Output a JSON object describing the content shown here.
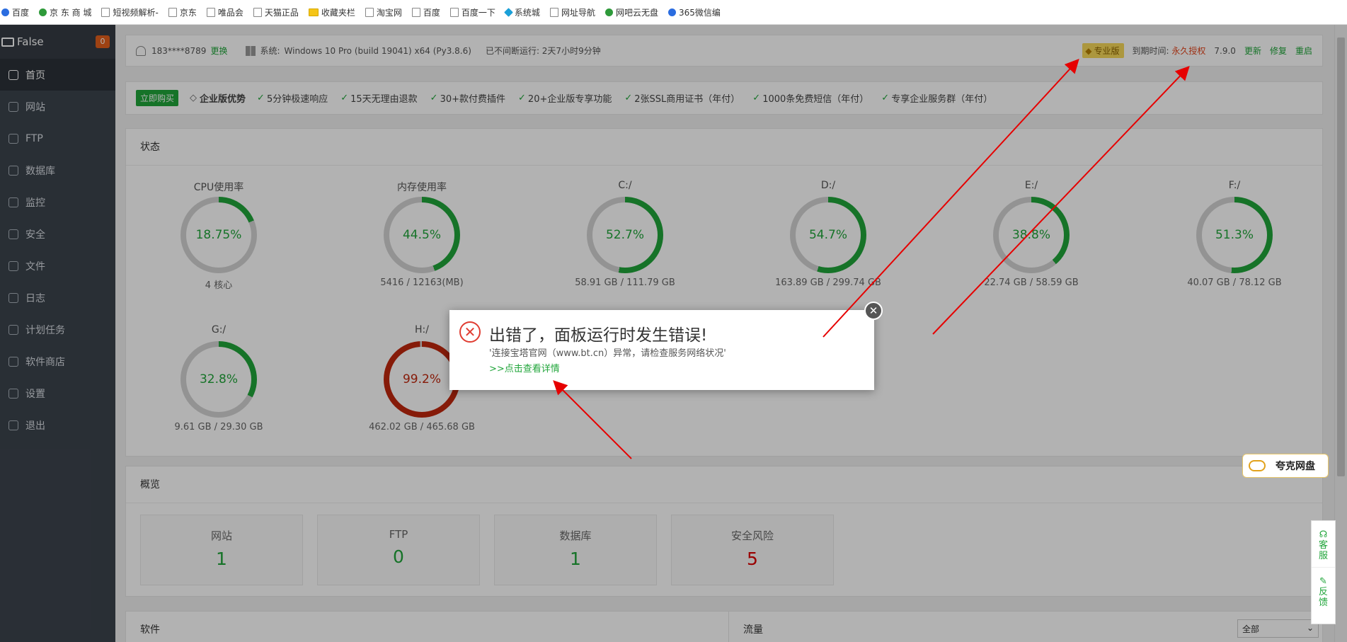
{
  "bookmarks": [
    {
      "label": "百度",
      "icon": "baidu-icon"
    },
    {
      "label": "京 东 商 城",
      "icon": "jd-icon"
    },
    {
      "label": "短视频解析-",
      "icon": "page-icon"
    },
    {
      "label": "京东",
      "icon": "page-icon"
    },
    {
      "label": "唯品会",
      "icon": "page-icon"
    },
    {
      "label": "天猫正品",
      "icon": "page-icon"
    },
    {
      "label": "收藏夹栏",
      "icon": "folder-icon"
    },
    {
      "label": "淘宝网",
      "icon": "page-icon"
    },
    {
      "label": "百度",
      "icon": "page-icon"
    },
    {
      "label": "百度一下",
      "icon": "page-icon"
    },
    {
      "label": "系统城",
      "icon": "xitongcheng-icon"
    },
    {
      "label": "网址导航",
      "icon": "page-icon"
    },
    {
      "label": "网吧云无盘",
      "icon": "wangba-icon"
    },
    {
      "label": "365微信编",
      "icon": "wechat-editor-icon"
    }
  ],
  "sidebar": {
    "host": "False",
    "badge": "0",
    "items": [
      {
        "label": "首页",
        "icon": "home-icon"
      },
      {
        "label": "网站",
        "icon": "globe-icon"
      },
      {
        "label": "FTP",
        "icon": "ftp-icon"
      },
      {
        "label": "数据库",
        "icon": "database-icon"
      },
      {
        "label": "监控",
        "icon": "monitor-icon"
      },
      {
        "label": "安全",
        "icon": "shield-icon"
      },
      {
        "label": "文件",
        "icon": "folder-icon"
      },
      {
        "label": "日志",
        "icon": "log-icon"
      },
      {
        "label": "计划任务",
        "icon": "calendar-icon"
      },
      {
        "label": "软件商店",
        "icon": "apps-icon"
      },
      {
        "label": "设置",
        "icon": "gear-icon"
      },
      {
        "label": "退出",
        "icon": "logout-icon"
      }
    ]
  },
  "topbar": {
    "user": "183****8789",
    "change": "更换",
    "system_label": "系统:",
    "system": "Windows 10 Pro (build 19041) x64 (Py3.8.6)",
    "uptime": "已不间断运行: 2天7小时9分钟",
    "pro": "专业版",
    "expire_label": "到期时间:",
    "expire_value": "永久授权",
    "version": "7.9.0",
    "update": "更新",
    "repair": "修复",
    "restart": "重启"
  },
  "promo": {
    "buy": "立即购买",
    "enterprise": "企业版优势",
    "features": [
      "5分钟极速响应",
      "15天无理由退款",
      "30+款付费插件",
      "20+企业版专享功能",
      "2张SSL商用证书（年付）",
      "1000条免费短信（年付）",
      "专享企业服务群（年付）"
    ]
  },
  "status": {
    "title": "状态",
    "gauges": [
      {
        "name": "CPU使用率",
        "value": "18.75%",
        "pct": 18.75,
        "sub": "4 核心",
        "color": "#20a53a"
      },
      {
        "name": "内存使用率",
        "value": "44.5%",
        "pct": 44.5,
        "sub": "5416 / 12163(MB)",
        "color": "#20a53a"
      },
      {
        "name": "C:/",
        "value": "52.7%",
        "pct": 52.7,
        "sub": "58.91 GB / 111.79 GB",
        "color": "#20a53a"
      },
      {
        "name": "D:/",
        "value": "54.7%",
        "pct": 54.7,
        "sub": "163.89 GB / 299.74 GB",
        "color": "#20a53a"
      },
      {
        "name": "E:/",
        "value": "38.8%",
        "pct": 38.8,
        "sub": "22.74 GB / 58.59 GB",
        "color": "#20a53a"
      },
      {
        "name": "F:/",
        "value": "51.3%",
        "pct": 51.3,
        "sub": "40.07 GB / 78.12 GB",
        "color": "#20a53a"
      },
      {
        "name": "G:/",
        "value": "32.8%",
        "pct": 32.8,
        "sub": "9.61 GB / 29.30 GB",
        "color": "#20a53a"
      },
      {
        "name": "H:/",
        "value": "99.2%",
        "pct": 99.2,
        "sub": "462.02 GB / 465.68 GB",
        "color": "#c0270e"
      }
    ]
  },
  "overview": {
    "title": "概览",
    "items": [
      {
        "label": "网站",
        "value": "1"
      },
      {
        "label": "FTP",
        "value": "0"
      },
      {
        "label": "数据库",
        "value": "1"
      },
      {
        "label": "安全风险",
        "value": "5"
      }
    ]
  },
  "software": {
    "title": "软件"
  },
  "traffic": {
    "title": "流量",
    "select": "全部"
  },
  "dialog": {
    "title": "出错了，面板运行时发生错误!",
    "message": "'连接宝塔官网（www.bt.cn）异常，请检查服务网络状况'",
    "link": ">>点击查看详情"
  },
  "quark": {
    "label": "夸克网盘"
  },
  "service": {
    "kefu": "客服",
    "feedback": "反馈"
  }
}
